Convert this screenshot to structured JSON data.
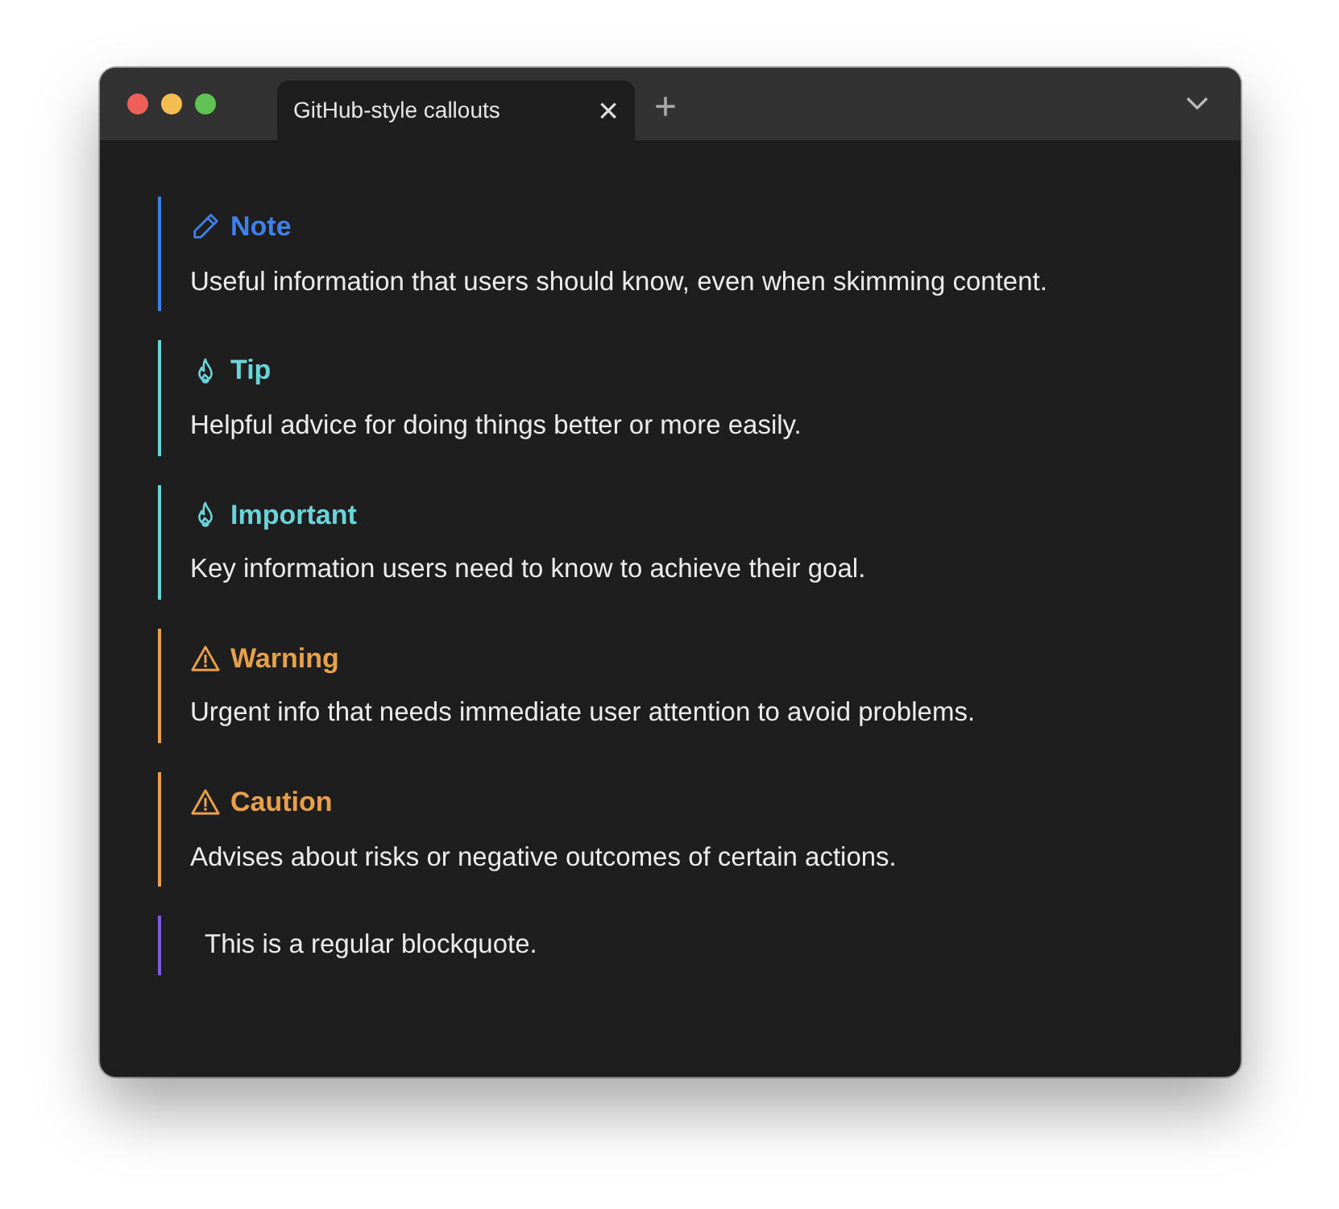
{
  "window": {
    "traffic_lights": [
      {
        "color": "#ee5f57"
      },
      {
        "color": "#f4bd4f"
      },
      {
        "color": "#5fc453"
      }
    ]
  },
  "tabs": [
    {
      "label": "GitHub-style callouts",
      "selected": true,
      "close": "×"
    }
  ],
  "new_tab": "+",
  "callouts": [
    {
      "kind": "note",
      "color": "#3f80ea",
      "title": "Note",
      "text": "Useful information that users should know, even when skimming content."
    },
    {
      "kind": "tip",
      "color": "#6ad4d8",
      "title": "Tip",
      "text": "Helpful advice for doing things better or more easily."
    },
    {
      "kind": "important",
      "color": "#6ad4d8",
      "title": "Important",
      "text": "Key information users need to know to achieve their goal."
    },
    {
      "kind": "warning",
      "color": "#e8a14a",
      "title": "Warning",
      "text": "Urgent info that needs immediate user attention to avoid problems."
    },
    {
      "kind": "caution",
      "color": "#e8a14a",
      "title": "Caution",
      "text": "Advises about risks or negative outcomes of certain actions."
    },
    {
      "kind": "quote",
      "color": "#7d5ce0",
      "text": "This is a regular blockquote."
    }
  ]
}
